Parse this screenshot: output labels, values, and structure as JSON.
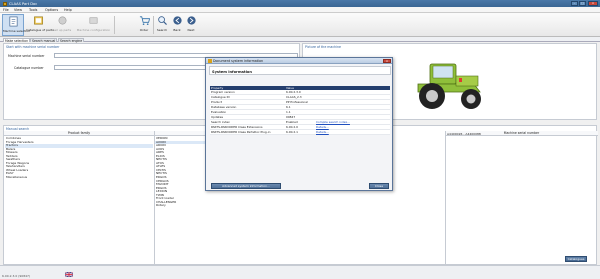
{
  "window": {
    "title": "CLAAS Part Doc"
  },
  "menu": [
    "File",
    "View",
    "Tools",
    "Options",
    "Help"
  ],
  "toolbar": [
    {
      "label": "Machine selection",
      "icon": "machine-selection-icon",
      "active": true,
      "dim": false
    },
    {
      "label": "Catalogue of parts",
      "icon": "catalogue-icon",
      "active": false,
      "dim": false
    },
    {
      "label": "Set up parts",
      "icon": "setup-parts-icon",
      "active": false,
      "dim": true
    },
    {
      "label": "Machine configuration",
      "icon": "machine-configuration-icon",
      "active": false,
      "dim": true
    },
    {
      "label": "Order",
      "icon": "cart-icon",
      "active": false,
      "dim": false
    },
    {
      "label": "Search",
      "icon": "search-icon",
      "active": false,
      "dim": false
    },
    {
      "label": "Back",
      "icon": "back-icon",
      "active": false,
      "dim": false
    },
    {
      "label": "Next",
      "icon": "next-icon",
      "active": false,
      "dim": false
    }
  ],
  "tabs": [
    "Make selection",
    "Search manual",
    "Search engine"
  ],
  "selection": {
    "title": "Start with machine serial number",
    "serial_label": "Machine serial number",
    "catalogue_label": "Catalogue number"
  },
  "picture": {
    "title": "Picture of the machine"
  },
  "manual_search": {
    "title": "Manual search",
    "col_product_family": "Product family",
    "col_serial": "Machine serial number",
    "range_text": "A4400026 - A4400088",
    "families": [
      "Combines",
      "Forage Harvesters",
      "Tractors",
      "Balers",
      "Mowers",
      "Tedders",
      "Swathers",
      "Forage Wagons",
      "Telehandlers",
      "Wheel Loaders",
      "EASY",
      "Miscellaneous"
    ],
    "selected_family": 2,
    "models": [
      "XERION",
      "AXION",
      "ARION",
      "AXOS",
      "ARES",
      "ELIOS",
      "NECTIS",
      "ATOS",
      "ATLES",
      "CELTIS",
      "NECTIS",
      "ERGOS",
      "CERGOS",
      "FAVORIT",
      "ERGOS",
      "LEXION",
      "TWIN",
      "Front loader",
      "CHALLENGER",
      "Rotary"
    ],
    "selected_model": 1
  },
  "status": {
    "version_text": "6.00.2.3.0 (90847)"
  },
  "buttons": {
    "catalogue": "Catalogues"
  },
  "dialog": {
    "title": "Document system information",
    "heading": "System information",
    "columns": [
      "Property",
      "Value"
    ],
    "rows": [
      {
        "prop": "Program version",
        "value": "6.00.2.3.0",
        "link": ""
      },
      {
        "prop": "Catalogue ID",
        "value": "CLAAS_2.3",
        "link": ""
      },
      {
        "prop": "Product",
        "value": "PP Professional",
        "link": ""
      },
      {
        "prop": "Database version",
        "value": "6.1",
        "link": ""
      },
      {
        "prop": "Evaluation",
        "value": "1.1",
        "link": ""
      },
      {
        "prop": "Updates",
        "value": "00847",
        "link": ""
      },
      {
        "prop": "Search index",
        "value": "Enabled",
        "link": "Compile search index..."
      },
      {
        "prop": "PARTS-PARDODER Claas Extensions",
        "value": "6.00.2.0",
        "link": "Details..."
      },
      {
        "prop": "PARTS-PARDODER Claas PartsDoc Plug-in",
        "value": "6.00.2.1",
        "link": "Details..."
      }
    ],
    "advanced_button": "Advanced system information...",
    "close_button": "Close"
  },
  "colors": {
    "accent": "#243e6e",
    "title_blue": "#2e5f9b",
    "link": "#1f4fbf"
  }
}
